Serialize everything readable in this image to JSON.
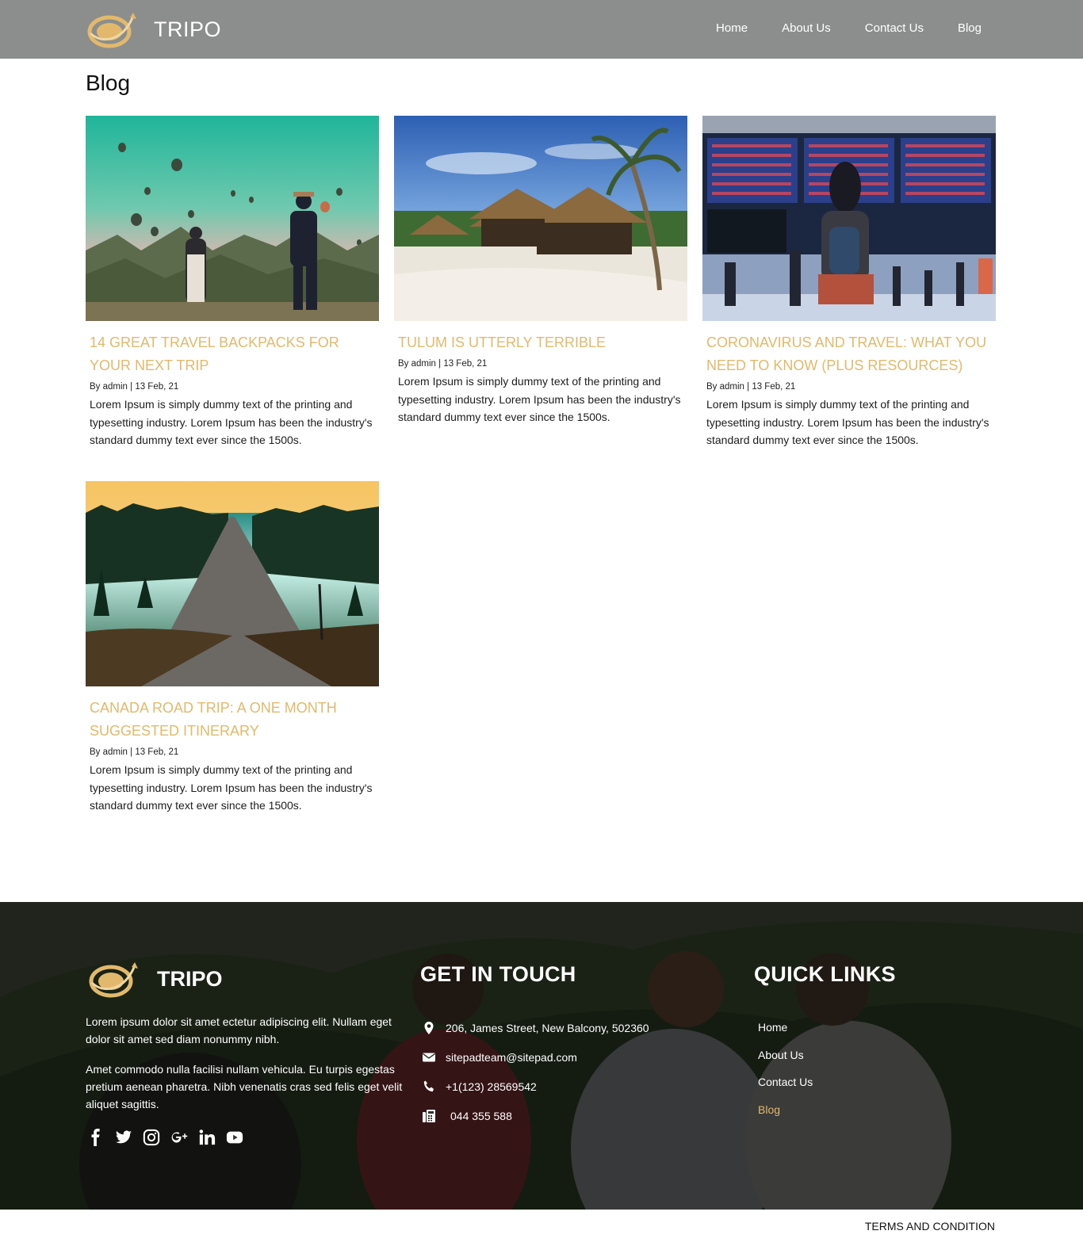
{
  "brand": {
    "name": "TRIPO",
    "accent": "#e2b96c",
    "header_bg": "#8c8e8d"
  },
  "nav": [
    {
      "label": "Home"
    },
    {
      "label": "About Us"
    },
    {
      "label": "Contact Us"
    },
    {
      "label": "Blog"
    }
  ],
  "page": {
    "title": "Blog"
  },
  "posts": [
    {
      "title": "14 GREAT TRAVEL BACKPACKS FOR YOUR NEXT TRIP",
      "meta": "By admin | 13 Feb, 21",
      "excerpt": "Lorem Ipsum is simply dummy text of the printing and typesetting industry. Lorem Ipsum has been the industry's standard dummy text ever since the 1500s.",
      "image": "hot-air-balloons-photographer"
    },
    {
      "title": "TULUM IS UTTERLY TERRIBLE",
      "meta": "By admin | 13 Feb, 21",
      "excerpt": "Lorem Ipsum is simply dummy text of the printing and typesetting industry. Lorem Ipsum has been the industry's standard dummy text ever since the 1500s.",
      "image": "beach-huts-palm"
    },
    {
      "title": "CORONAVIRUS AND TRAVEL: WHAT YOU NEED TO KNOW (PLUS RESOURCES)",
      "meta": "By admin | 13 Feb, 21",
      "excerpt": "Lorem Ipsum is simply dummy text of the printing and typesetting industry. Lorem Ipsum has been the industry's standard dummy text ever since the 1500s.",
      "image": "airport-departure-board"
    },
    {
      "title": "CANADA ROAD TRIP: A ONE MONTH SUGGESTED ITINERARY",
      "meta": "By admin | 13 Feb, 21",
      "excerpt": "Lorem Ipsum is simply dummy text of the printing and typesetting industry. Lorem Ipsum has been the industry's standard dummy text ever since the 1500s.",
      "image": "misty-forest-road"
    }
  ],
  "footer": {
    "brand": "TRIPO",
    "about_1": "Lorem ipsum dolor sit amet ectetur adipiscing elit. Nullam eget dolor sit amet sed diam nonummy nibh.",
    "about_2": "Amet commodo nulla facilisi nullam vehicula. Eu turpis egestas pretium aenean pharetra. Nibh venenatis cras sed felis eget velit aliquet sagittis.",
    "social": [
      "facebook-icon",
      "twitter-icon",
      "instagram-icon",
      "google-plus-icon",
      "linkedin-icon",
      "youtube-icon"
    ],
    "contact": {
      "heading": "GET IN TOUCH",
      "address": "206, James Street, New Balcony, 502360",
      "email": "sitepadteam@sitepad.com",
      "phone": "+1(123) 28569542",
      "fax": "044 355 588"
    },
    "links": {
      "heading": "QUICK LINKS",
      "items": [
        {
          "label": "Home"
        },
        {
          "label": "About Us"
        },
        {
          "label": "Contact Us"
        },
        {
          "label": "Blog"
        }
      ],
      "active_color": "#e2b96c"
    },
    "terms": "TERMS AND CONDITION"
  }
}
